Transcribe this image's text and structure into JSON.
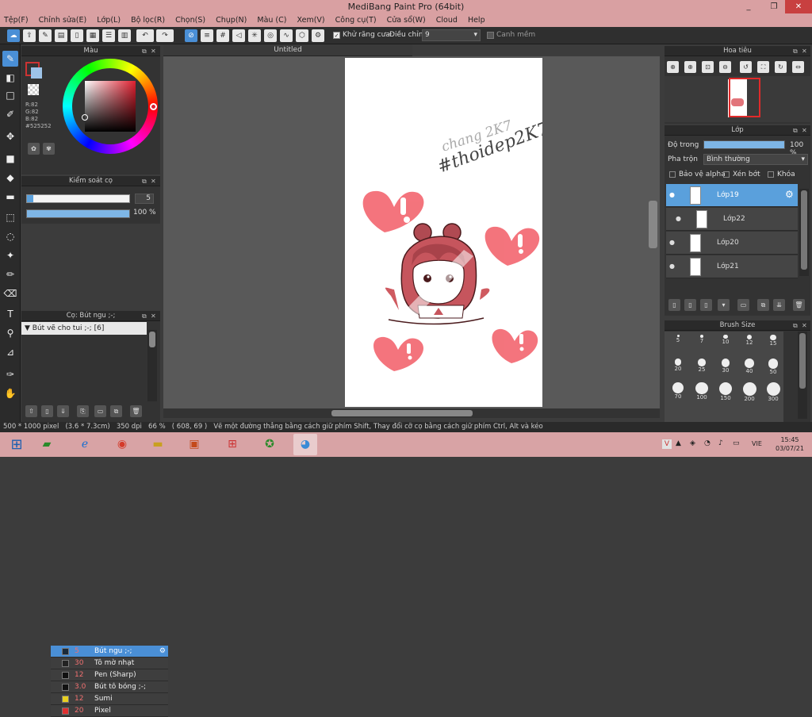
{
  "window": {
    "title": "MediBang Paint Pro (64bit)",
    "minimize": "_",
    "restore": "❐",
    "close": "✕"
  },
  "menu": [
    "Tệp(F)",
    "Chỉnh sửa(E)",
    "Lớp(L)",
    "Bộ lọc(R)",
    "Chọn(S)",
    "Chụp(N)",
    "Màu (C)",
    "Xem(V)",
    "Công cụ(T)",
    "Cửa sổ(W)",
    "Cloud",
    "Help"
  ],
  "toolbar": {
    "antialias_label": "Khử răng cưa",
    "antialias_checked": true,
    "adjust_label": "Điều chỉnh",
    "adjust_value": "9",
    "edge_label": "Canh mềm"
  },
  "document": {
    "tab_title": "Untitled",
    "text_lines": [
      "chang 2K7",
      "#thoidep2K7"
    ]
  },
  "color_panel": {
    "title": "Màu",
    "primary": "#525252",
    "accent": "#e03040",
    "rgb": [
      "R:82",
      "G:82",
      "B:82"
    ],
    "hex_label": "#525252"
  },
  "brush_control": {
    "title": "Kiểm soát cọ",
    "size": "5",
    "opacity": "100 %",
    "opacity_fraction": 1.0
  },
  "brush_list": {
    "title": "Cọ: Bút ngu ;-;",
    "group": "Bút vẽ cho tui ;-; [6]",
    "items": [
      {
        "size": "5",
        "name": "Bút ngu ;-;",
        "color": "#1a2a3a",
        "selected": true
      },
      {
        "size": "30",
        "name": "Tô mờ nhạt",
        "color": "#222222",
        "selected": false
      },
      {
        "size": "12",
        "name": "Pen (Sharp)",
        "color": "#111111",
        "selected": false
      },
      {
        "size": "3.0",
        "name": "Bút tô bóng ;-;",
        "color": "#111111",
        "selected": false
      },
      {
        "size": "12",
        "name": "Sumi",
        "color": "#e8d020",
        "selected": false
      },
      {
        "size": "20",
        "name": "Pixel",
        "color": "#e03030",
        "selected": false
      }
    ]
  },
  "navigator": {
    "title": "Hoa tiêu"
  },
  "layers_panel": {
    "title": "Lớp",
    "opacity_label": "Độ trong",
    "opacity_value": "100 %",
    "opacity_fraction": 1.0,
    "blend_label": "Pha trộn",
    "blend_value": "Bình thường",
    "protect_alpha": "Bảo vệ alpha",
    "clipping": "Xén bớt",
    "lock": "Khóa",
    "layers": [
      {
        "name": "Lớp19",
        "selected": true
      },
      {
        "name": "Lớp22",
        "selected": false
      },
      {
        "name": "Lớp20",
        "selected": false
      },
      {
        "name": "Lớp21",
        "selected": false
      }
    ]
  },
  "brush_size_panel": {
    "title": "Brush Size",
    "sizes": [
      "5",
      "7",
      "10",
      "12",
      "15",
      "20",
      "25",
      "30",
      "40",
      "50",
      "70",
      "100",
      "150",
      "200",
      "300"
    ]
  },
  "statusbar": {
    "canvas_size": "500 * 1000 pixel",
    "physical": "(3.6 * 7.3cm)",
    "dpi": "350 dpi",
    "zoom": "66 %",
    "cursor": "( 608, 69 )",
    "hint": "Vẽ một đường thẳng bằng cách giữ phím Shift, Thay đổi cỡ cọ bằng cách giữ phím Ctrl, Alt và kéo"
  },
  "taskbar": {
    "language": "VIE",
    "time": "15:45",
    "date": "03/07/21"
  }
}
